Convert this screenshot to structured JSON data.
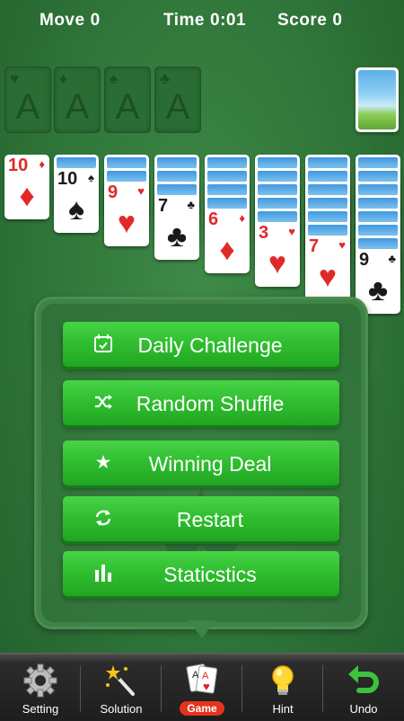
{
  "header": {
    "move_label": "Move",
    "move_value": "0",
    "time_label": "Time",
    "time_value": "0:01",
    "score_label": "Score",
    "score_value": "0"
  },
  "foundations": [
    {
      "suit": "♥",
      "letter": "A"
    },
    {
      "suit": "♦",
      "letter": "A"
    },
    {
      "suit": "♠",
      "letter": "A"
    },
    {
      "suit": "♣",
      "letter": "A"
    }
  ],
  "tableau": [
    {
      "rank": "10",
      "suit": "♦",
      "color": "red",
      "face_down": 0
    },
    {
      "rank": "10",
      "suit": "♠",
      "color": "black",
      "face_down": 1
    },
    {
      "rank": "9",
      "suit": "♥",
      "color": "red",
      "face_down": 2
    },
    {
      "rank": "7",
      "suit": "♣",
      "color": "black",
      "face_down": 3
    },
    {
      "rank": "6",
      "suit": "♦",
      "color": "red",
      "face_down": 4
    },
    {
      "rank": "3",
      "suit": "♥",
      "color": "red",
      "face_down": 5
    },
    {
      "rank": "7",
      "suit": "♥",
      "color": "red",
      "face_down": 6
    },
    {
      "rank": "9",
      "suit": "♣",
      "color": "black",
      "face_down": 7
    }
  ],
  "menu": {
    "daily_challenge": "Daily Challenge",
    "random_shuffle": "Random Shuffle",
    "winning_deal": "Winning Deal",
    "restart": "Restart",
    "statistics": "Staticstics"
  },
  "bottom_nav": {
    "setting": "Setting",
    "solution": "Solution",
    "game": "Game",
    "hint": "Hint",
    "undo": "Undo"
  },
  "colors": {
    "felt": "#2f7539",
    "button_green": "#2fbd2f",
    "card_red": "#e02a2a",
    "game_badge": "#e5331f"
  }
}
